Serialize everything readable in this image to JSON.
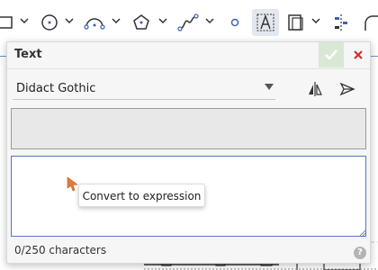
{
  "toolbar": {
    "tools": [
      {
        "icon": "rectangle-icon",
        "active": false
      },
      {
        "icon": "circle-icon",
        "active": false
      },
      {
        "icon": "arc-icon",
        "active": false
      },
      {
        "icon": "polygon-icon",
        "active": false
      },
      {
        "icon": "spline-icon",
        "active": false
      },
      {
        "icon": "point-icon",
        "active": false
      },
      {
        "icon": "text-tool-icon",
        "active": true
      },
      {
        "icon": "offset-icon",
        "active": false
      },
      {
        "icon": "align-icon",
        "active": false
      },
      {
        "icon": "fillet-icon",
        "active": false
      }
    ],
    "active_color": "#e3e7ee"
  },
  "dialog": {
    "title": "Text",
    "font_select": {
      "value": "Didact Gothic"
    },
    "text_area": {
      "value": ""
    },
    "char_count": "0/250 characters",
    "help_symbol": "?",
    "ok_color": "#d8e8d4",
    "ok_check_color": "#ffffff",
    "cancel_color": "#d0312d",
    "text_area_border": "#4f79c1"
  },
  "context_menu": {
    "items": [
      {
        "label": "Convert to expression"
      }
    ]
  },
  "cursor": {
    "color": "#e07b39"
  }
}
